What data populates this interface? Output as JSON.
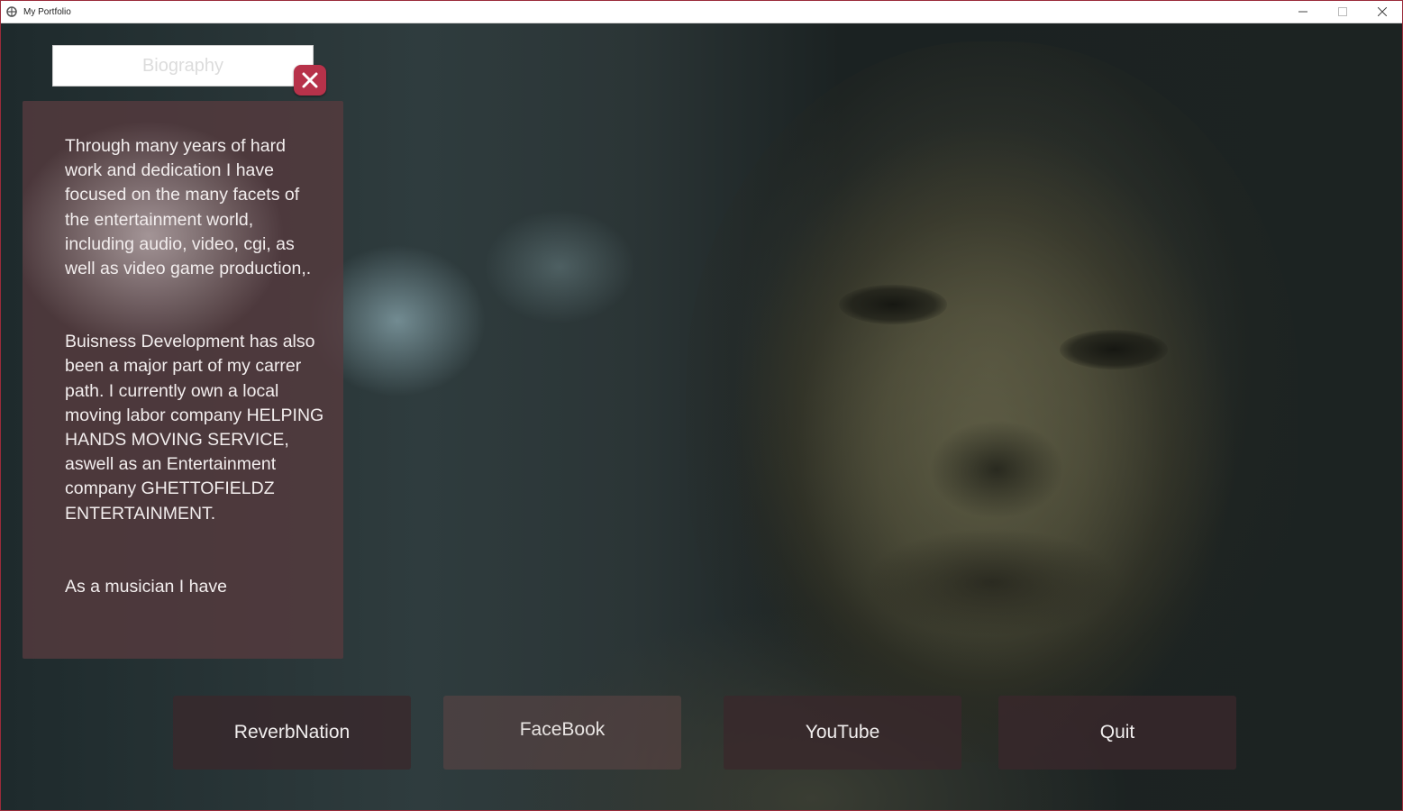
{
  "window": {
    "title": "My Portfolio",
    "controls": {
      "minimize": "minimize-icon",
      "maximize": "maximize-icon",
      "close": "close-icon"
    }
  },
  "panel": {
    "title_placeholder": "Biography",
    "close_icon": "close-x-icon",
    "paragraphs": [
      "Through many years of hard work and dedication  I have focused on the many facets of the entertainment world, including audio, video, cgi, as well as video game production,.",
      "Buisness Development has also been a major part of my carrer path. I currently own a local moving labor company HELPING HANDS MOVING SERVICE, aswell as an Entertainment company GHETTOFIELDZ ENTERTAINMENT.",
      "As a musician I have"
    ]
  },
  "buttons": {
    "reverbnation": "ReverbNation",
    "facebook": "FaceBook",
    "youtube": "YouTube",
    "quit": "Quit"
  },
  "colors": {
    "close_button": "#b7324a",
    "panel_bg": "#563a3e",
    "window_border": "#9b2b3a"
  }
}
